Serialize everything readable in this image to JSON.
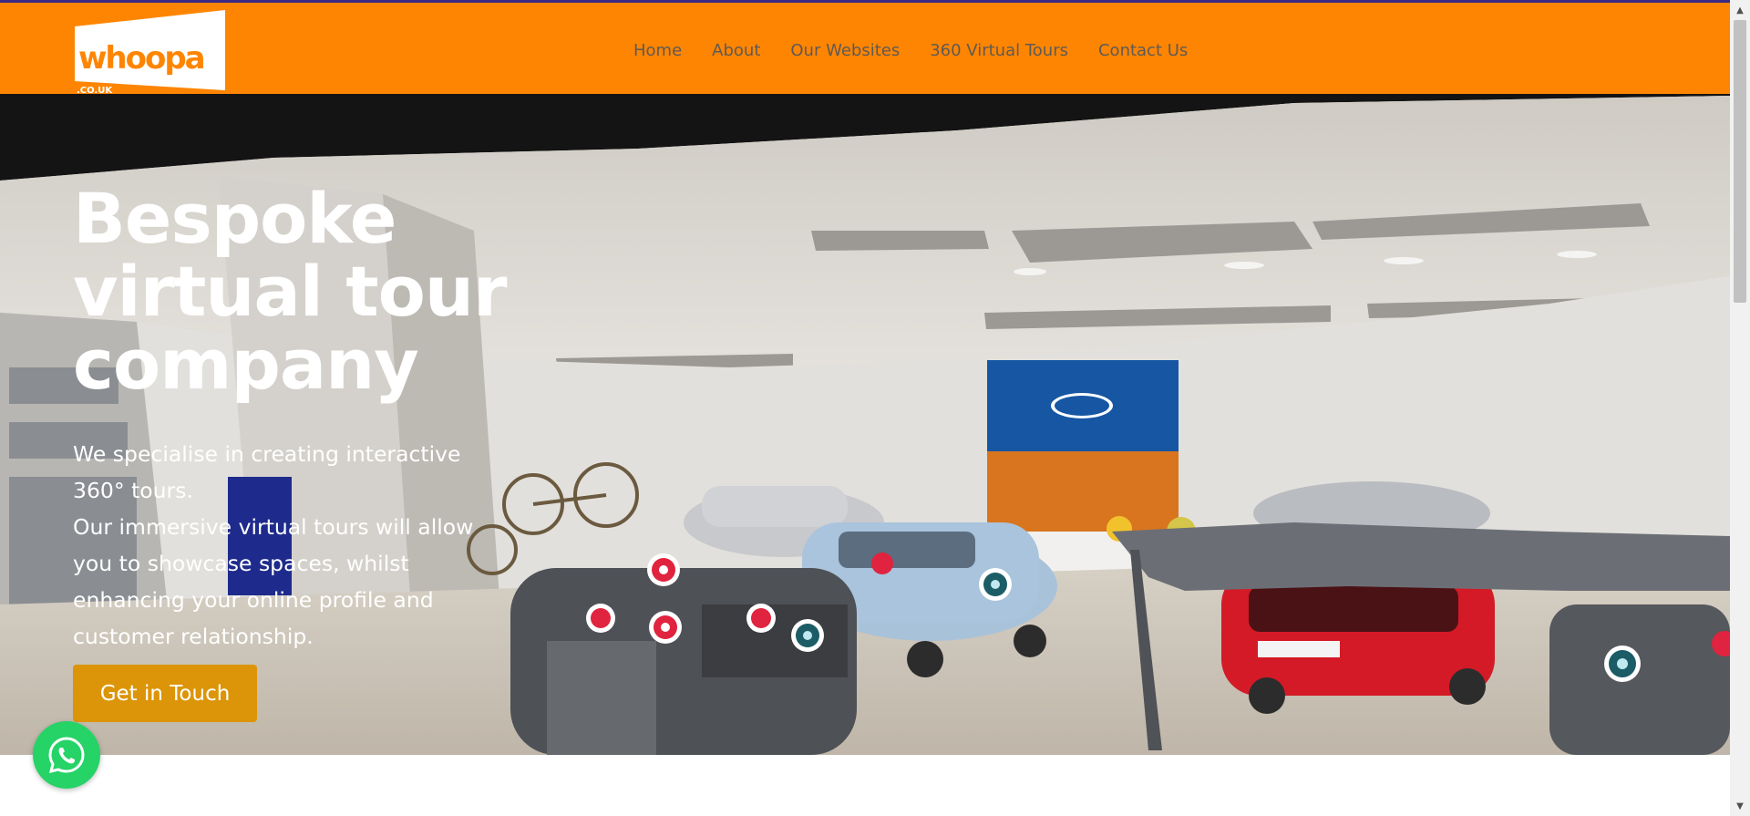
{
  "header": {
    "logo": {
      "text_main": "whoopa",
      "text_domain": ".CO.UK",
      "icon": "whoopa-logo"
    },
    "nav": [
      {
        "label": "Home"
      },
      {
        "label": "About"
      },
      {
        "label": "Our Websites"
      },
      {
        "label": "360 Virtual Tours"
      },
      {
        "label": "Contact Us"
      }
    ]
  },
  "hero": {
    "title": "Bespoke virtual tour company",
    "paragraph_1": "We specialise in creating interactive 360° tours.",
    "paragraph_2": "Our immersive virtual tours will allow you to showcase spaces, whilst enhancing your online profile and customer relationship.",
    "cta_label": "Get in Touch",
    "background_icon": "car-showroom-360-image"
  },
  "floating": {
    "whatsapp_icon": "whatsapp-icon"
  },
  "colors": {
    "header_bg": "#fe8502",
    "nav_text": "#5e5a55",
    "cta_bg": "#dc9508",
    "whatsapp_bg": "#25d366",
    "top_strip": "#3b2a84"
  }
}
